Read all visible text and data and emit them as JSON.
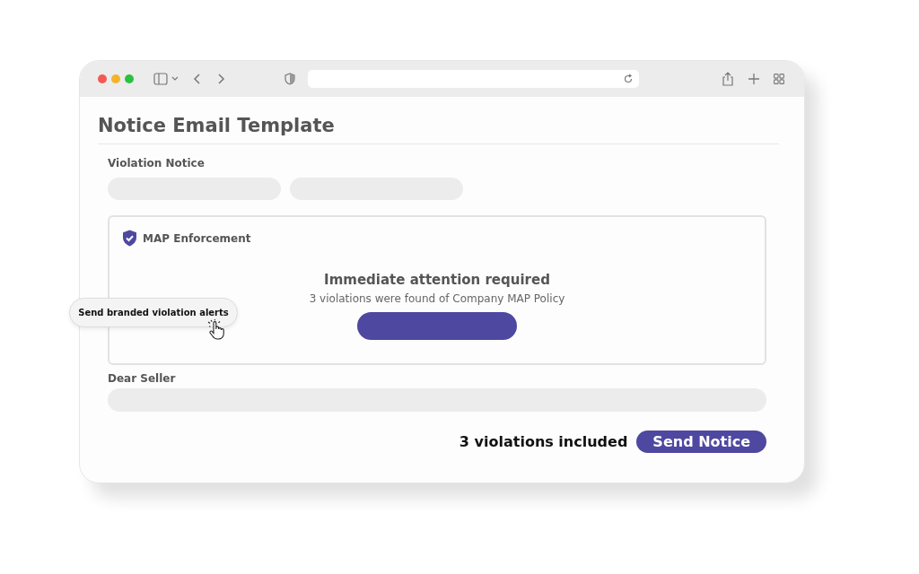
{
  "window": {
    "title": "Notice Email Template"
  },
  "violation_notice": {
    "label": "Violation Notice"
  },
  "email_card": {
    "brand": "MAP Enforcement",
    "heading": "Immediate attention required",
    "message": "3 violations were found of Company MAP Policy"
  },
  "greeting": {
    "label": "Dear Seller"
  },
  "footer": {
    "summary": "3 violations included",
    "button": "Send Notice"
  },
  "tooltip": {
    "text": "Send branded violation alerts"
  }
}
